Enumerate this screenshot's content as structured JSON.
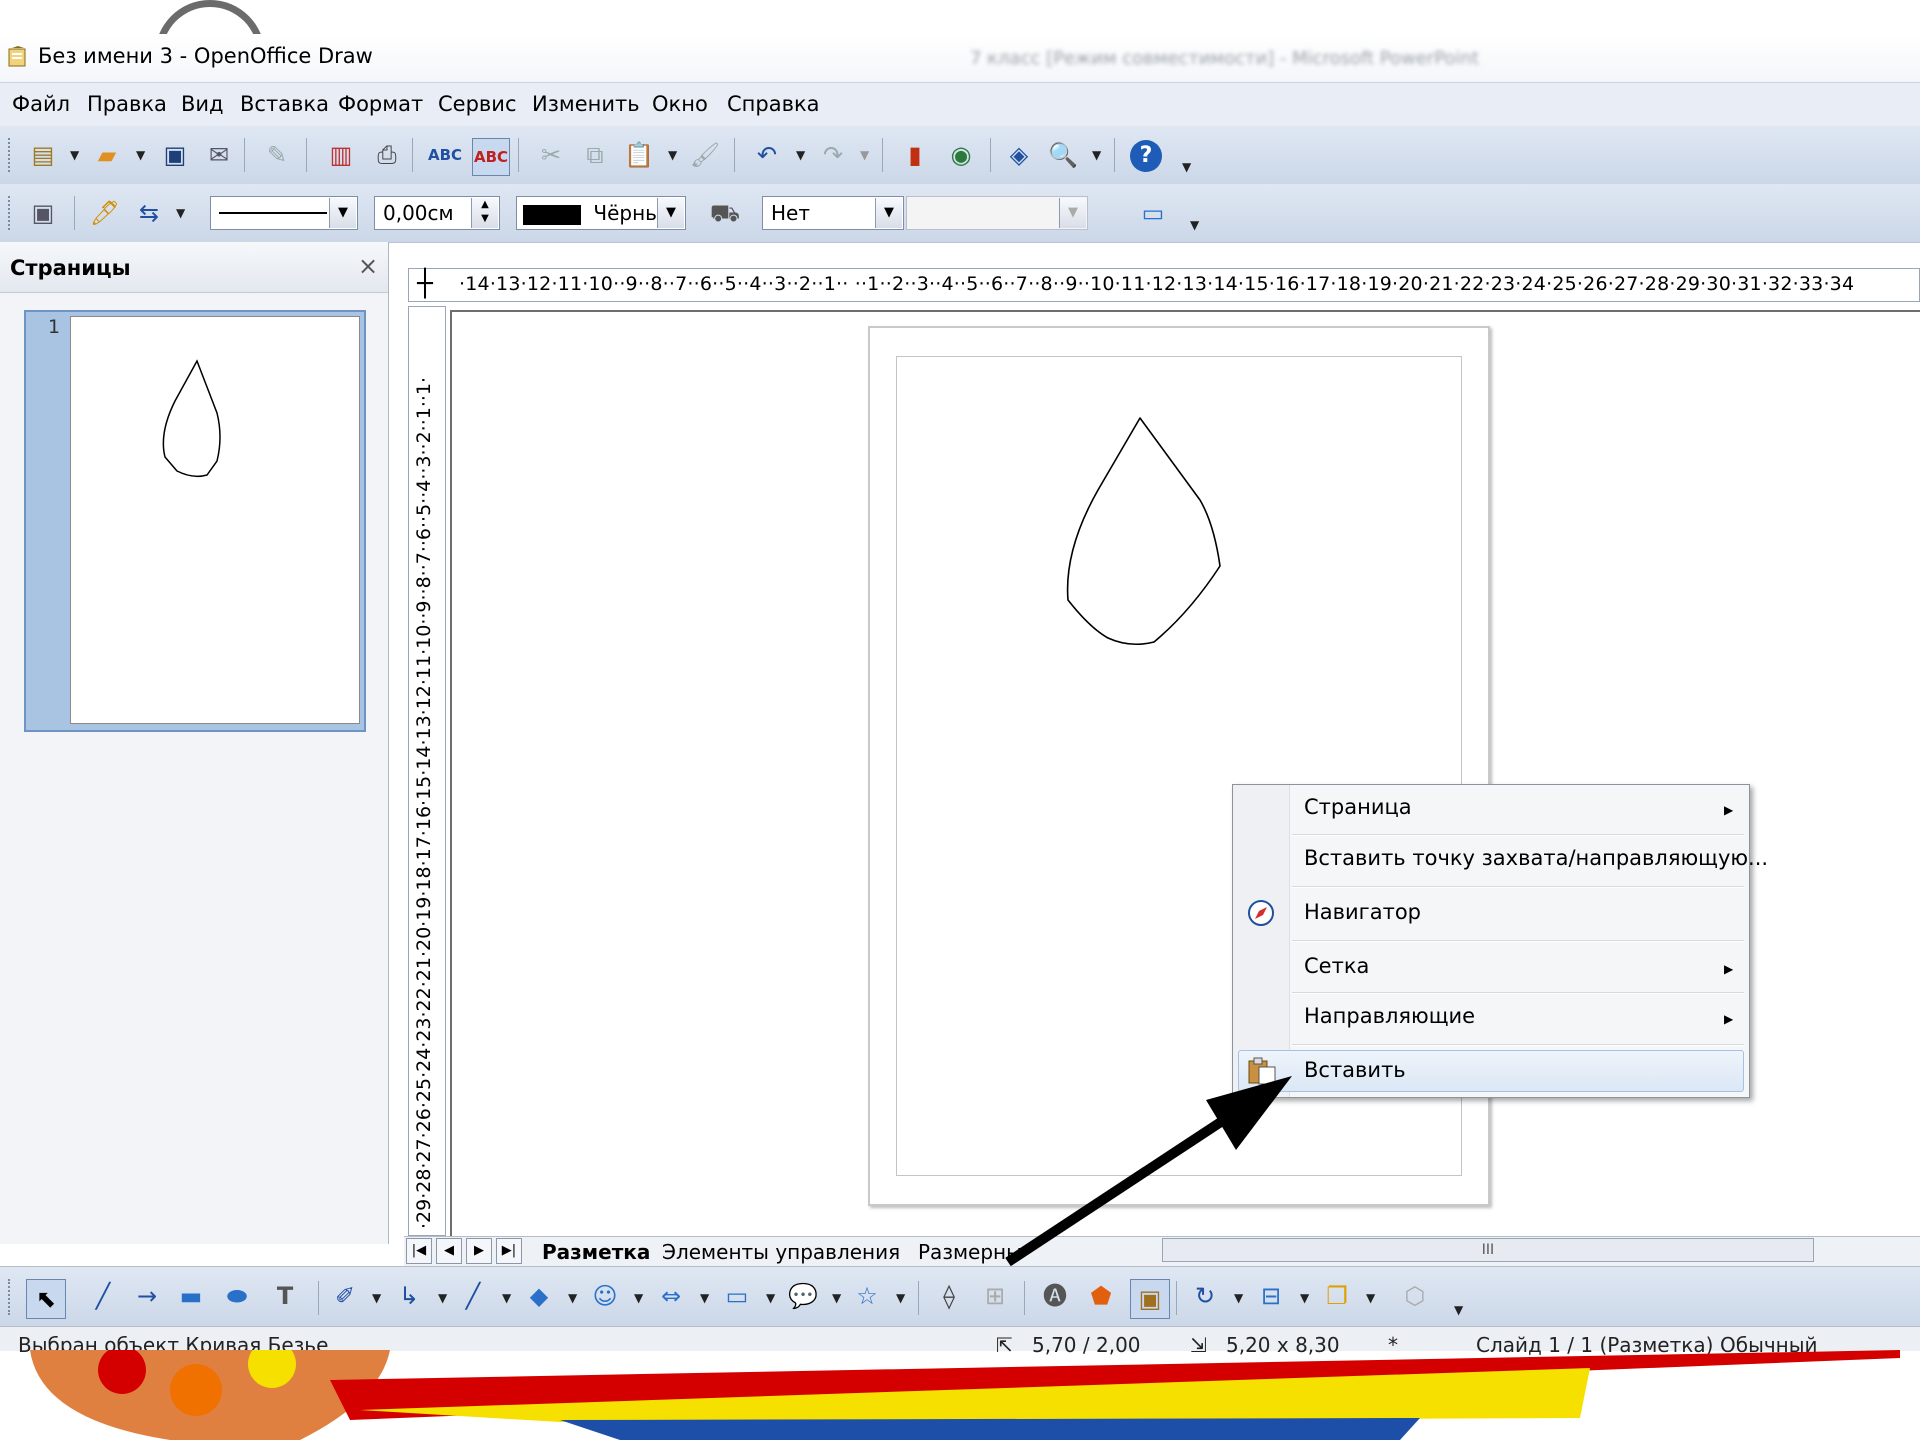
{
  "window": {
    "title": "Без имени 3 - OpenOffice Draw",
    "background_window_title": "7 класс [Режим совместимости] - Microsoft PowerPoint"
  },
  "menu": [
    "Файл",
    "Правка",
    "Вид",
    "Вставка",
    "Формат",
    "Сервис",
    "Изменить",
    "Окно",
    "Справка"
  ],
  "line_toolbar": {
    "line_width": "0,00см",
    "line_color": "Чёрны",
    "area_style": "Нет",
    "area_value": ""
  },
  "pages_panel": {
    "title": "Страницы",
    "close": "×",
    "thumbnail_number": "1"
  },
  "rulers": {
    "corner": "┼",
    "horizontal": "·14·13·12·11·10··9··8··7··6··5··4··3··2··1··  ··1··2··3··4··5··6··7··8··9··10·11·12·13·14·15·16·17·18·19·20·21·22·23·24·25·26·27·28·29·30·31·32·33·34",
    "vertical": "·29·28·27·26·25·24·23·22·21·20·19·18·17·16·15·14·13·12·11·10··9··8··7··6··5··4··3··2··1··1·"
  },
  "tabs": [
    "Разметка",
    "Элементы управления",
    "Размерные"
  ],
  "scroll_grip": "III",
  "context_menu": [
    {
      "label": "Страница",
      "submenu": true,
      "icon": ""
    },
    {
      "label": "Вставить точку захвата/направляющую...",
      "submenu": false,
      "icon": ""
    },
    {
      "label": "Навигатор",
      "submenu": false,
      "icon": "navigator-compass-icon"
    },
    {
      "label": "Сетка",
      "submenu": true,
      "icon": ""
    },
    {
      "label": "Направляющие",
      "submenu": true,
      "icon": ""
    },
    {
      "label": "Вставить",
      "submenu": false,
      "icon": "paste-clipboard-icon",
      "highlighted": true
    }
  ],
  "statusbar": {
    "message": "Выбран объект Кривая Безье",
    "position": "5,70 / 2,00",
    "size": "5,20 x 8,30",
    "modified": "*",
    "slide": "Слайд 1 / 1 (Разметка)",
    "style": "Обычный"
  },
  "colors": {
    "accent_highlight": "#dbe7f5",
    "toolbar": "#cbd7e8",
    "deco_red": "#d40000",
    "deco_yellow": "#f5e000",
    "deco_blue": "#1e4fa8",
    "deco_palette": "#e08040"
  }
}
